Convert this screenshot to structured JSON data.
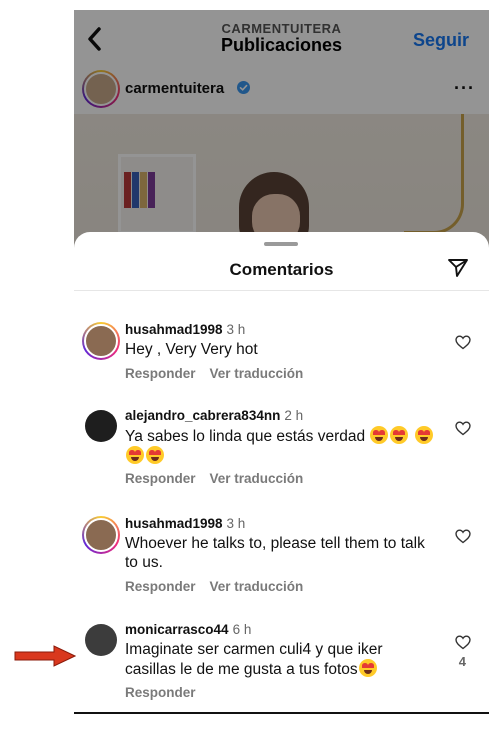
{
  "header": {
    "subtitle": "CARMENTUITERA",
    "title": "Publicaciones",
    "follow_label": "Seguir"
  },
  "post": {
    "username": "carmentuitera",
    "more": "···"
  },
  "sheet": {
    "title": "Comentarios"
  },
  "comments": [
    {
      "user": "husahmad1998",
      "time": "3 h",
      "text": "Hey , Very Very hot",
      "actions": [
        "Responder",
        "Ver traducción"
      ],
      "likes": ""
    },
    {
      "user": "alejandro_cabrera834nn",
      "time": "2 h",
      "text": "Ya sabes lo linda que estás verdad 😍😍😍😍😍",
      "text_plain": "Ya sabes lo linda que estás verdad",
      "actions": [
        "Responder",
        "Ver traducción"
      ],
      "likes": ""
    },
    {
      "user": "husahmad1998",
      "time": "3 h",
      "text": "Whoever he talks to, please tell them to talk to us.",
      "actions": [
        "Responder",
        "Ver traducción"
      ],
      "likes": ""
    },
    {
      "user": "monicarrasco44",
      "time": "6 h",
      "text": "Imaginate ser carmen culi4 y que iker casillas le de me gusta a tus fotos😍",
      "text_plain": "Imaginate ser carmen culi4 y que iker casillas le de me gusta a tus fotos",
      "actions": [
        "Responder"
      ],
      "likes": "4"
    }
  ],
  "colors": {
    "accent": "#1877f2",
    "arrow": "#d9381e",
    "secondary_text": "#7a7a7a"
  },
  "icons": [
    "back-icon",
    "verified-icon",
    "more-icon",
    "send-icon",
    "heart-icon",
    "arrow-annotation"
  ]
}
